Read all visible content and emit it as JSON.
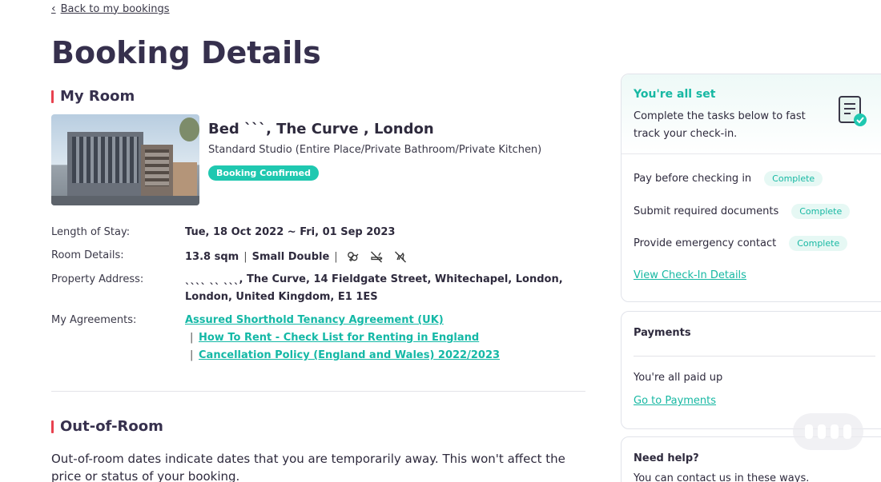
{
  "nav": {
    "back_label": "Back to my bookings"
  },
  "page": {
    "title": "Booking Details"
  },
  "my_room": {
    "heading": "My Room",
    "property_name": "Bed ˋˋˋ, The Curve , London",
    "room_type": "Standard Studio (Entire Place/Private Bathroom/Private Kitchen)",
    "status": "Booking Confirmed",
    "labels": {
      "length_of_stay": "Length of Stay:",
      "room_details": "Room Details:",
      "property_address": "Property Address:",
      "agreements": "My Agreements:"
    },
    "length_of_stay": "Tue, 18 Oct 2022 ~ Fri, 01 Sep 2023",
    "room_size": "13.8 sqm",
    "bed_type": "Small Double",
    "amenity_icons": [
      "gender-symbol-icon",
      "no-smoking-icon",
      "no-pets-icon"
    ],
    "address_line1": "ˎˎˎˎ ˎˎ ˎˎˎ, The Curve, 14 Fieldgate Street, Whitechapel, London,",
    "address_line2": "London, United Kingdom, E1 1ES",
    "agreements": [
      "Assured Shorthold Tenancy Agreement (UK)",
      "How To Rent - Check List for Renting in England",
      "Cancellation Policy (England and Wales) 2022/2023"
    ],
    "agreement_separator": "|",
    "detail_separator": "|"
  },
  "out_of_room": {
    "heading": "Out-of-Room",
    "text": "Out-of-room dates indicate dates that you are temporarily away. This won't affect the price or status of your booking."
  },
  "checkin": {
    "title": "You're all set",
    "subtitle": "Complete the tasks below to fast track your check-in.",
    "tasks": [
      {
        "label": "Pay before checking in",
        "status": "Complete"
      },
      {
        "label": "Submit required documents",
        "status": "Complete"
      },
      {
        "label": "Provide emergency contact",
        "status": "Complete"
      }
    ],
    "link": "View Check-In Details"
  },
  "payments": {
    "heading": "Payments",
    "status_text": "You're all paid up",
    "link": "Go to Payments"
  },
  "help": {
    "heading": "Need help?",
    "text": "You can contact us in these ways."
  },
  "colors": {
    "accent_teal": "#17b8a3",
    "pill_teal": "#1fc8b0",
    "heading_bar_red": "#e8424f",
    "title_purple": "#36304d"
  }
}
